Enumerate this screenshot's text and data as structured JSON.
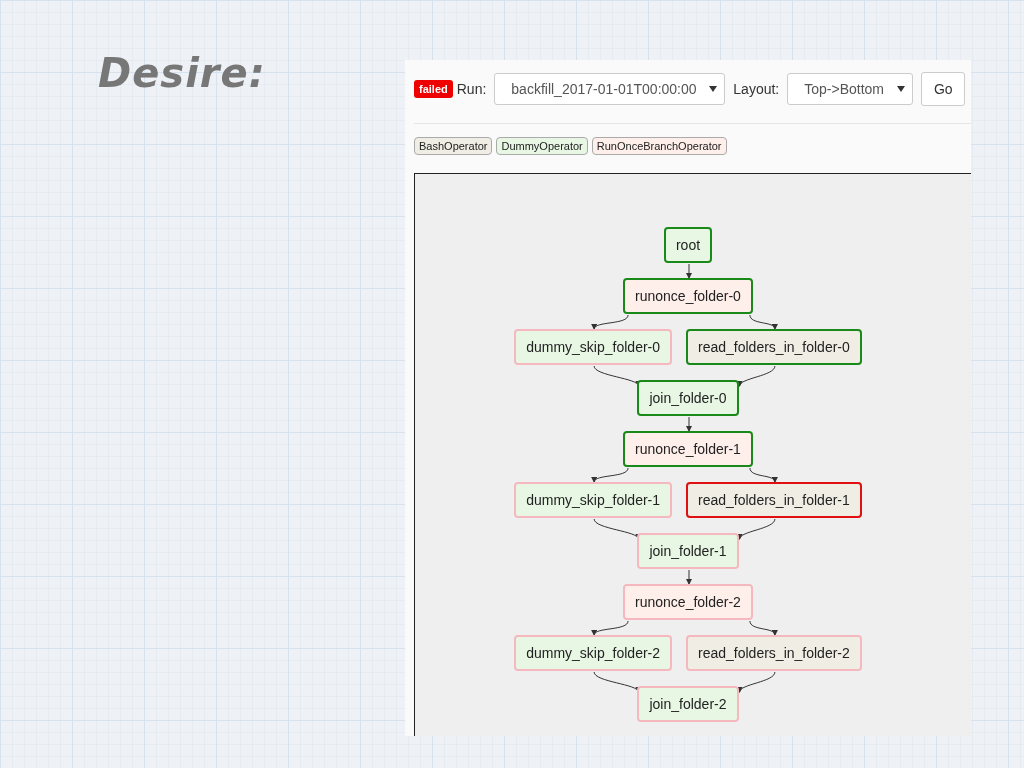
{
  "slide_title": "Desire:",
  "toolbar": {
    "status_badge": "failed",
    "run_label": "Run:",
    "run_value": "backfill_2017-01-01T00:00:00",
    "layout_label": "Layout:",
    "layout_value": "Top->Bottom",
    "go_button": "Go"
  },
  "legend": [
    {
      "label": "BashOperator",
      "color": "#f0ede4"
    },
    {
      "label": "DummyOperator",
      "color": "#e8f7e4"
    },
    {
      "label": "RunOnceBranchOperator",
      "color": "#ffefeb"
    }
  ],
  "graph": {
    "rows": [
      [
        {
          "label": "root",
          "color": "#e8f7e4",
          "kind": "success"
        }
      ],
      [
        {
          "label": "runonce_folder-0",
          "color": "#ffefeb",
          "kind": "success"
        }
      ],
      [
        {
          "label": "dummy_skip_folder-0",
          "color": "#e8f7e4",
          "kind": "skipped"
        },
        {
          "label": "read_folders_in_folder-0",
          "color": "#f0ede4",
          "kind": "success"
        }
      ],
      [
        {
          "label": "join_folder-0",
          "color": "#e8f7e4",
          "kind": "success"
        }
      ],
      [
        {
          "label": "runonce_folder-1",
          "color": "#ffefeb",
          "kind": "success"
        }
      ],
      [
        {
          "label": "dummy_skip_folder-1",
          "color": "#e8f7e4",
          "kind": "skipped"
        },
        {
          "label": "read_folders_in_folder-1",
          "color": "#f0ede4",
          "kind": "failed"
        }
      ],
      [
        {
          "label": "join_folder-1",
          "color": "#e8f7e4",
          "kind": "skipped"
        }
      ],
      [
        {
          "label": "runonce_folder-2",
          "color": "#ffefeb",
          "kind": "skipped"
        }
      ],
      [
        {
          "label": "dummy_skip_folder-2",
          "color": "#e8f7e4",
          "kind": "skipped"
        },
        {
          "label": "read_folders_in_folder-2",
          "color": "#f0ede4",
          "kind": "skipped"
        }
      ],
      [
        {
          "label": "join_folder-2",
          "color": "#e8f7e4",
          "kind": "skipped"
        }
      ]
    ]
  }
}
